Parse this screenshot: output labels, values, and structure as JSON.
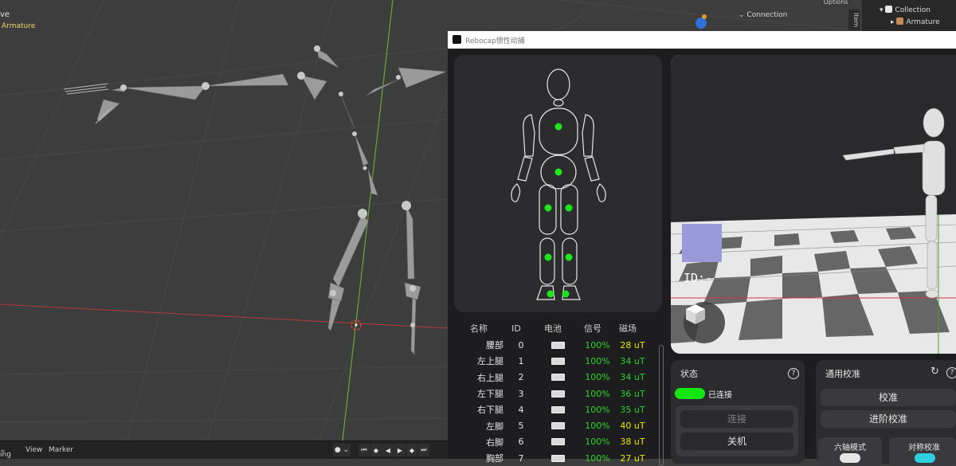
{
  "blender": {
    "mode_label": "ve",
    "object_label": "Armature",
    "header": {
      "connection_label": "Connection",
      "options_label": "Options",
      "item_tab": "Item"
    },
    "outliner": {
      "collection": "Collection",
      "armature": "Armature"
    },
    "timeline": {
      "menu_1": "ing",
      "menu_view": "View",
      "menu_marker": "Marker"
    }
  },
  "rebocap": {
    "window_title": "Rebocap惯性动捕",
    "scene": {
      "id_text": "ID:-"
    },
    "table": {
      "headers": [
        "名称",
        "ID",
        "电池",
        "信号",
        "磁场"
      ],
      "rows": [
        {
          "name": "腰部",
          "id": "0",
          "signal": "100%",
          "mag": "28 uT",
          "mag_color": "#e6e600"
        },
        {
          "name": "左上腿",
          "id": "1",
          "signal": "100%",
          "mag": "34 uT",
          "mag_color": "#2bd42b"
        },
        {
          "name": "右上腿",
          "id": "2",
          "signal": "100%",
          "mag": "34 uT",
          "mag_color": "#2bd42b"
        },
        {
          "name": "左下腿",
          "id": "3",
          "signal": "100%",
          "mag": "36 uT",
          "mag_color": "#2bd42b"
        },
        {
          "name": "右下腿",
          "id": "4",
          "signal": "100%",
          "mag": "35 uT",
          "mag_color": "#2bd42b"
        },
        {
          "name": "左脚",
          "id": "5",
          "signal": "100%",
          "mag": "40 uT",
          "mag_color": "#e6e600"
        },
        {
          "name": "右脚",
          "id": "6",
          "signal": "100%",
          "mag": "38 uT",
          "mag_color": "#e6e600"
        },
        {
          "name": "胸部",
          "id": "7",
          "signal": "100%",
          "mag": "27 uT",
          "mag_color": "#e6e600"
        }
      ]
    },
    "status": {
      "title": "状态",
      "connection_state": "已连接",
      "connect_button": "连接",
      "shutdown_button": "关机"
    },
    "calibration": {
      "title": "通用校准",
      "calibrate_button": "校准",
      "advanced_button": "进阶校准",
      "six_axis_label": "六轴模式",
      "symmetric_label": "对称校准"
    },
    "colors": {
      "accent_green": "#14e614",
      "sensor_dot": "#1ee61e"
    }
  }
}
